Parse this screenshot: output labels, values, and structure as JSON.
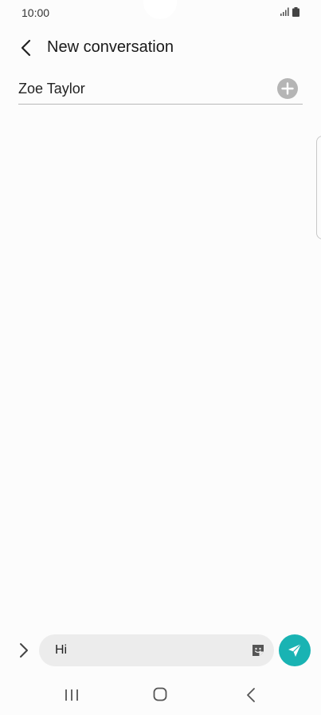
{
  "status_bar": {
    "time": "10:00",
    "icons": [
      "signal-icon",
      "battery-icon"
    ]
  },
  "header": {
    "title": "New conversation",
    "back_icon": "chevron-left-icon"
  },
  "recipient": {
    "name": "Zoe Taylor",
    "add_icon": "plus-icon"
  },
  "composer": {
    "expand_icon": "chevron-right-icon",
    "message_value": "Hi",
    "sticker_icon": "sticker-icon",
    "send_icon": "send-icon"
  },
  "nav_bar": {
    "icons": [
      "recents-icon",
      "home-icon",
      "back-icon"
    ]
  },
  "colors": {
    "accent": "#19b3b3",
    "background": "#fcfcfc",
    "field": "#ececec"
  }
}
